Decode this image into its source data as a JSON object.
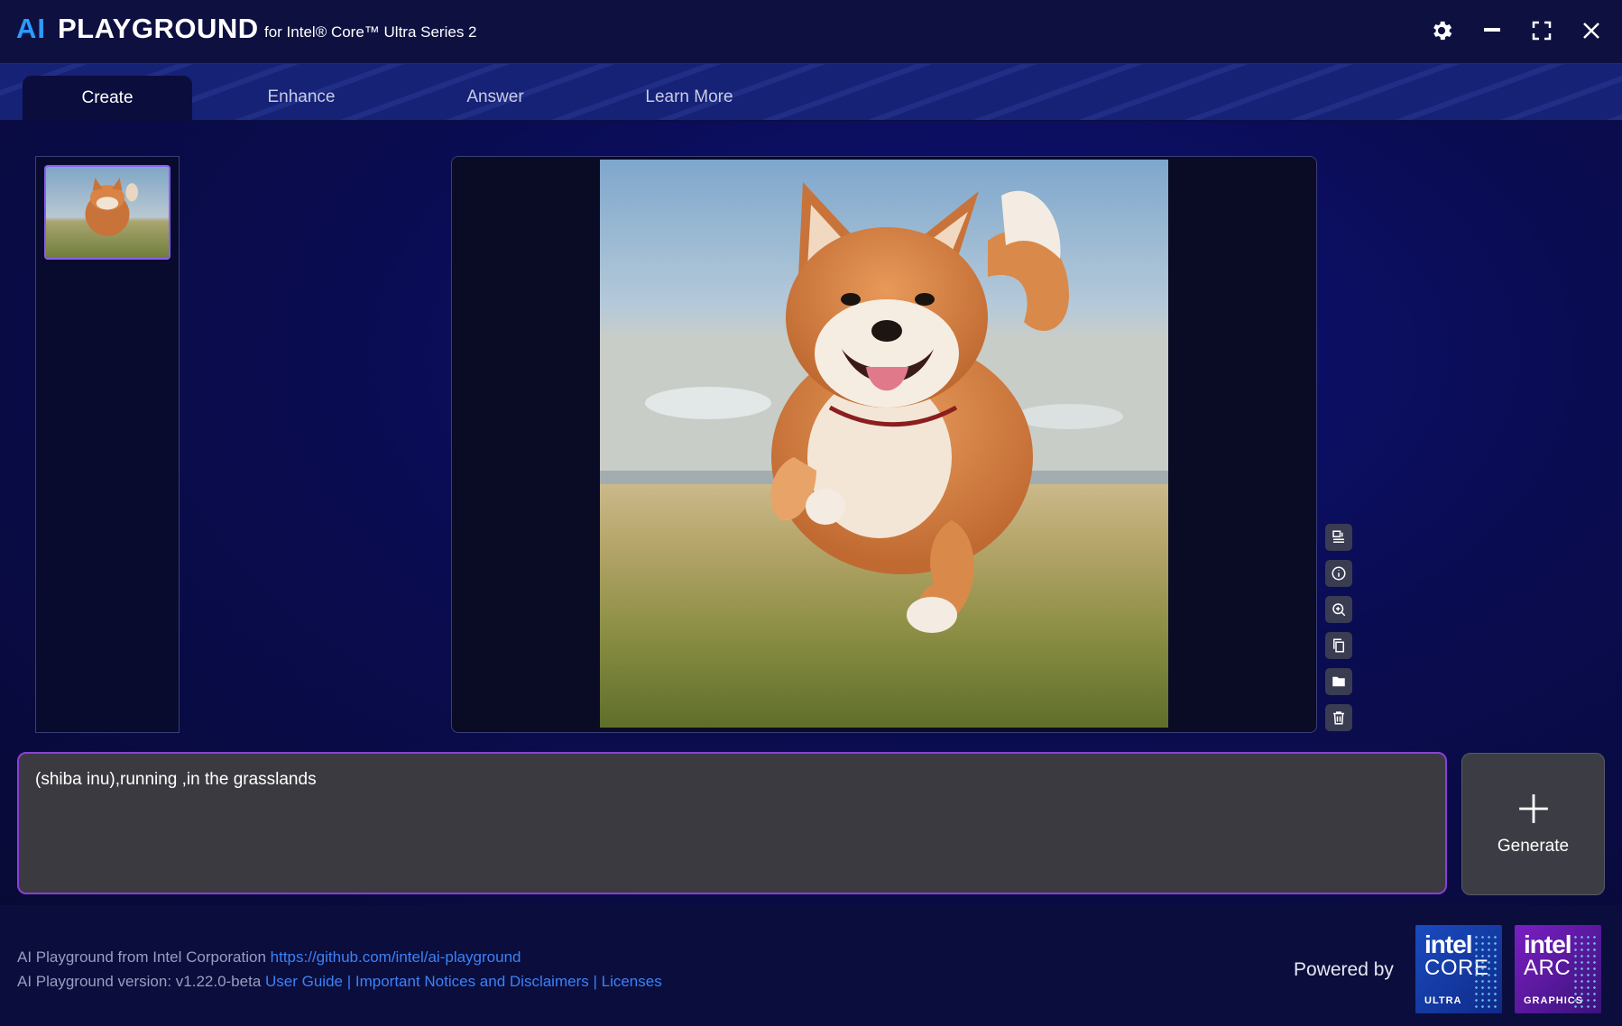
{
  "titlebar": {
    "brand_ai": "AI",
    "brand_name": "PLAYGROUND",
    "subtitle": "for Intel® Core™ Ultra Series 2",
    "icons": [
      "gear-icon",
      "minimize-icon",
      "maximize-icon",
      "close-icon"
    ]
  },
  "tabs": [
    {
      "label": "Create",
      "active": true
    },
    {
      "label": "Enhance",
      "active": false
    },
    {
      "label": "Answer",
      "active": false
    },
    {
      "label": "Learn More",
      "active": false
    }
  ],
  "viewer_tools": [
    "compare-icon",
    "info-icon",
    "zoom-in-icon",
    "copy-icon",
    "folder-icon",
    "trash-icon"
  ],
  "prompt": {
    "value": "(shiba inu),running ,in the grasslands"
  },
  "generate": {
    "label": "Generate"
  },
  "footer": {
    "line1_text": "AI Playground from Intel Corporation ",
    "line1_link": "https://github.com/intel/ai-playground",
    "line2_text": "AI Playground version: v1.22.0-beta ",
    "line2_links": [
      "User Guide",
      "Important Notices and Disclaimers",
      "Licenses"
    ],
    "separator": " | ",
    "powered_by": "Powered by",
    "badge_core": {
      "brand": "intel",
      "product": "CORE",
      "tier": "ULTRA"
    },
    "badge_arc": {
      "brand": "intel",
      "product": "ARC",
      "tier": "GRAPHICS"
    }
  },
  "colors": {
    "accent_blue": "#2c9bff",
    "link": "#3b82f6",
    "prompt_border": "#8a3fd8",
    "thumb_border": "#8b5cf6"
  }
}
